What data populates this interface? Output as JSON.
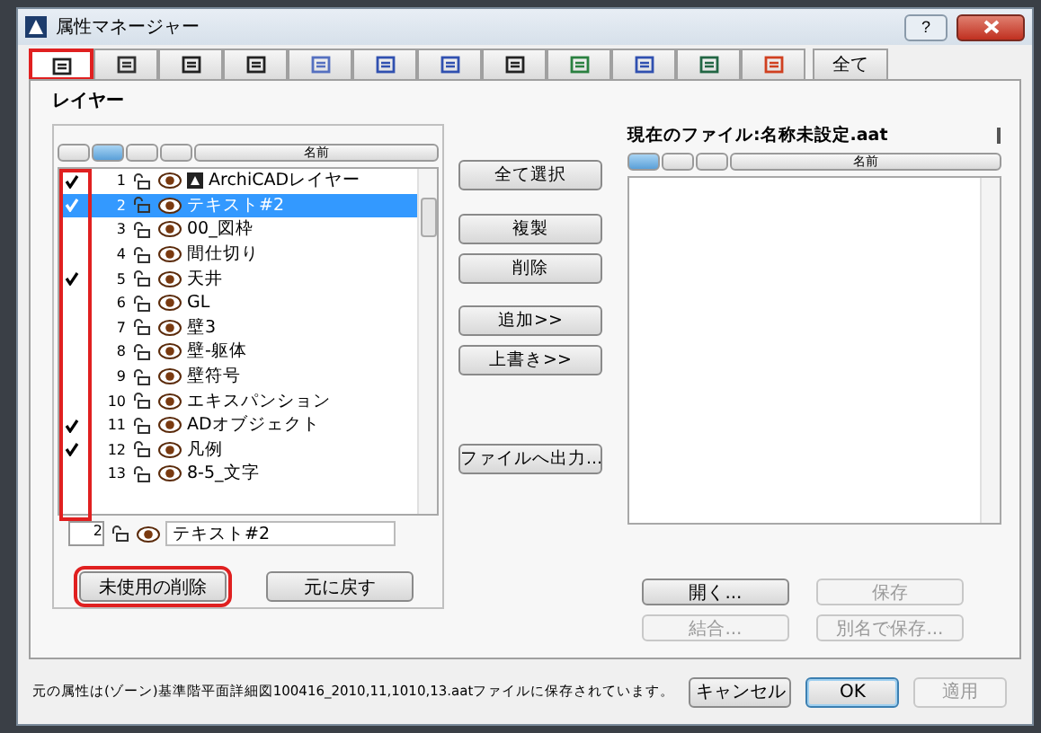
{
  "window": {
    "title": "属性マネージャー",
    "help": "?"
  },
  "tabs": [
    {
      "kind": "icon",
      "selected": true,
      "highlighted": true
    },
    {
      "kind": "icon",
      "selected": false,
      "highlighted": false
    },
    {
      "kind": "icon",
      "selected": false,
      "highlighted": false
    },
    {
      "kind": "icon",
      "selected": false,
      "highlighted": false
    },
    {
      "kind": "icon",
      "selected": false,
      "highlighted": false
    },
    {
      "kind": "icon",
      "selected": false,
      "highlighted": false
    },
    {
      "kind": "icon",
      "selected": false,
      "highlighted": false
    },
    {
      "kind": "icon",
      "selected": false,
      "highlighted": false
    },
    {
      "kind": "icon",
      "selected": false,
      "highlighted": false
    },
    {
      "kind": "icon",
      "selected": false,
      "highlighted": false
    },
    {
      "kind": "icon",
      "selected": false,
      "highlighted": false
    },
    {
      "kind": "icon",
      "selected": false,
      "highlighted": false
    },
    {
      "kind": "text",
      "label": "全て",
      "selected": false,
      "highlighted": false
    }
  ],
  "section_title": "レイヤー",
  "left_list": {
    "columns": [
      {
        "selected": false
      },
      {
        "selected": true
      },
      {
        "selected": false
      },
      {
        "selected": false
      },
      {
        "label": "名前",
        "selected": false
      }
    ],
    "check_column_highlighted": true,
    "rows": [
      {
        "number": "1",
        "name": "ArchiCADレイヤー",
        "kind": "system",
        "checked": true,
        "selected": false
      },
      {
        "number": "2",
        "name": "テキスト#2",
        "kind": "normal",
        "checked": true,
        "selected": true
      },
      {
        "number": "3",
        "name": "00_図枠",
        "kind": "normal",
        "checked": false,
        "selected": false
      },
      {
        "number": "4",
        "name": "間仕切り",
        "kind": "normal",
        "checked": false,
        "selected": false
      },
      {
        "number": "5",
        "name": "天井",
        "kind": "normal",
        "checked": true,
        "selected": false
      },
      {
        "number": "6",
        "name": "GL",
        "kind": "normal",
        "checked": false,
        "selected": false
      },
      {
        "number": "7",
        "name": "壁3",
        "kind": "normal",
        "checked": false,
        "selected": false
      },
      {
        "number": "8",
        "name": "壁-躯体",
        "kind": "normal",
        "checked": false,
        "selected": false
      },
      {
        "number": "9",
        "name": "壁符号",
        "kind": "normal",
        "checked": false,
        "selected": false
      },
      {
        "number": "10",
        "name": "エキスパンション",
        "kind": "normal",
        "checked": false,
        "selected": false
      },
      {
        "number": "11",
        "name": "ADオブジェクト",
        "kind": "normal",
        "checked": true,
        "selected": false
      },
      {
        "number": "12",
        "name": "凡例",
        "kind": "normal",
        "checked": true,
        "selected": false
      },
      {
        "number": "13",
        "name": "8-5_文字",
        "kind": "normal",
        "checked": false,
        "selected": false
      }
    ],
    "edit_row": {
      "number": "2",
      "value": "テキスト#2"
    },
    "buttons": [
      {
        "label": "未使用の削除",
        "highlighted": true
      },
      {
        "label": "元に戻す",
        "highlighted": false
      }
    ]
  },
  "middle_buttons": [
    {
      "label": "全て選択"
    },
    {
      "label": "複製"
    },
    {
      "label": "削除"
    },
    {
      "label": "追加>>"
    },
    {
      "label": "上書き>>"
    },
    {
      "label": "ファイルへ出力..."
    }
  ],
  "right_panel": {
    "title": "現在のファイル:名称未設定.aat",
    "columns": [
      {
        "selected": true
      },
      {
        "selected": false
      },
      {
        "selected": false
      },
      {
        "label": "名前",
        "selected": false
      }
    ],
    "buttons": [
      {
        "label": "開く...",
        "disabled": false
      },
      {
        "label": "保存",
        "disabled": true
      },
      {
        "label": "結合...",
        "disabled": true
      },
      {
        "label": "別名で保存...",
        "disabled": true
      }
    ]
  },
  "status_text": "元の属性は(ゾーン)基準階平面詳細図100416_2010,11,1010,13.aatファイルに保存されています。",
  "footer_buttons": [
    {
      "label": "キャンセル",
      "disabled": false,
      "default": false
    },
    {
      "label": "OK",
      "disabled": false,
      "default": true
    },
    {
      "label": "適用",
      "disabled": true,
      "default": false
    }
  ]
}
